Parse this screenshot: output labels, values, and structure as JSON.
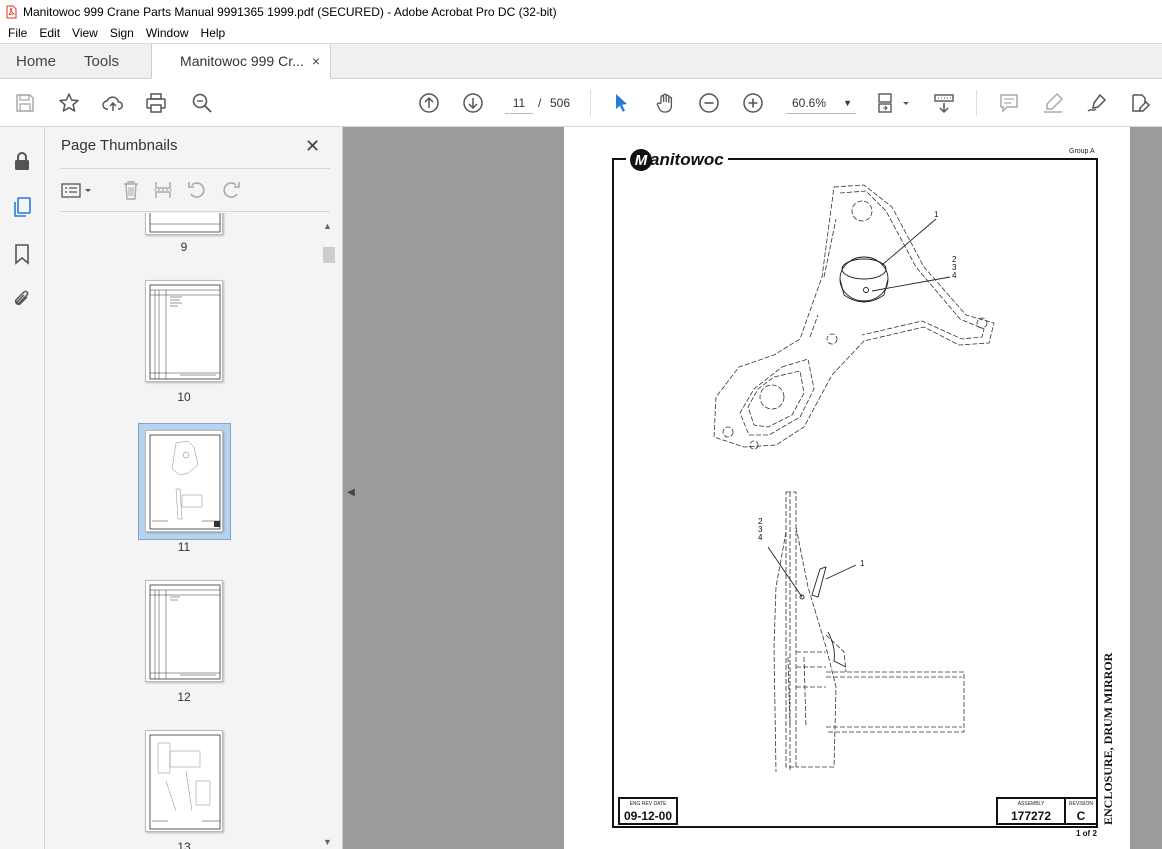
{
  "window": {
    "title": "Manitowoc 999 Crane Parts Manual 9991365 1999.pdf (SECURED) - Adobe Acrobat Pro DC (32-bit)"
  },
  "menu": [
    "File",
    "Edit",
    "View",
    "Sign",
    "Window",
    "Help"
  ],
  "tabs": {
    "home": "Home",
    "tools": "Tools",
    "document": "Manitowoc 999 Cr...",
    "close": "×"
  },
  "toolbar": {
    "current_page": "11",
    "separator": "/",
    "total_pages": "506",
    "zoom": "60.6%"
  },
  "thumbnails": {
    "title": "Page Thumbnails",
    "close": "✕",
    "pages": [
      {
        "label": "9"
      },
      {
        "label": "10"
      },
      {
        "label": "11",
        "selected": true
      },
      {
        "label": "12"
      },
      {
        "label": "13"
      }
    ]
  },
  "document": {
    "group": "Group A",
    "logo_text": "anitowoc",
    "logo_mark": "M",
    "date_caption": "ENG REV DATE",
    "date_value": "09-12-00",
    "assembly_caption": "ASSEMBLY",
    "assembly_value": "177272",
    "revision_caption": "REVISION",
    "revision_value": "C",
    "sheet": "1 of 2",
    "drawing_title": "ENCLOSURE, DRUM MIRROR",
    "callouts": {
      "top_one": "1",
      "top_two": "2",
      "top_three": "3",
      "top_four": "4",
      "bottom_one": "1",
      "bottom_two": "2",
      "bottom_three": "3",
      "bottom_four": "4"
    }
  },
  "colors": {
    "toolbar_bg": "#ffffff",
    "panel_bg": "#f4f4f4",
    "doc_bg": "#9b9b9b",
    "select_blue": "#2a7bd4",
    "thumb_selected": "#b8d4ec"
  }
}
